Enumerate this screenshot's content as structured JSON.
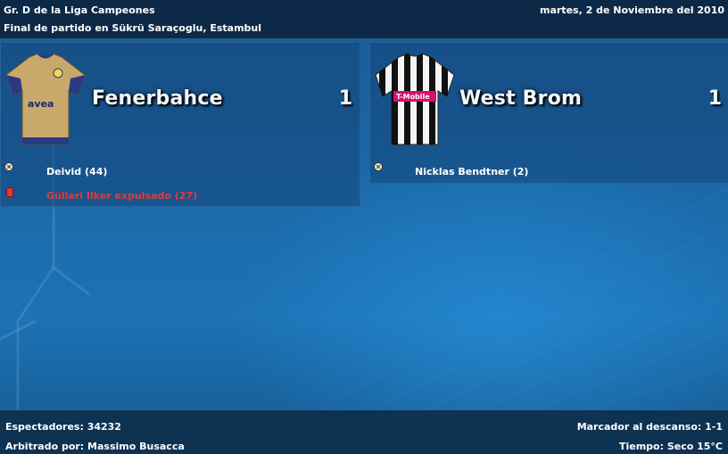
{
  "header": {
    "competition": "Gr. D de la Liga Campeones",
    "date": "martes, 2 de Noviembre del 2010",
    "status_venue": "Final de partido en Sükrü Saraçoglu, Estambul"
  },
  "home": {
    "name": "Fenerbahce",
    "score": "1",
    "events": [
      {
        "type": "goal",
        "text": "Deivid (44)",
        "color": "#ffffff"
      },
      {
        "type": "red-card",
        "text": "Gülleri Ilker expulsado (27)",
        "color": "#e03a3a"
      }
    ],
    "kit_sponsor": "avea"
  },
  "away": {
    "name": "West Brom",
    "score": "1",
    "events": [
      {
        "type": "goal",
        "text": "Nicklas Bendtner (2)",
        "color": "#ffffff"
      }
    ],
    "kit_sponsor": "T-Mobile"
  },
  "footer": {
    "attendance": "Espectadores: 34232",
    "referee": "Arbitrado por: Massimo Busacca",
    "half_time": "Marcador al descanso: 1-1",
    "weather": "Tiempo: Seco 15°C"
  },
  "colors": {
    "header_bg": "#0c2a48",
    "footer_bg": "#0d3252",
    "red_card": "#e03a3a",
    "home_kit": "#c9a96b",
    "away_kit_stripes": "#111111"
  },
  "icons": [
    "ball-icon",
    "red-card-icon",
    "home-kit-icon",
    "away-kit-icon"
  ]
}
